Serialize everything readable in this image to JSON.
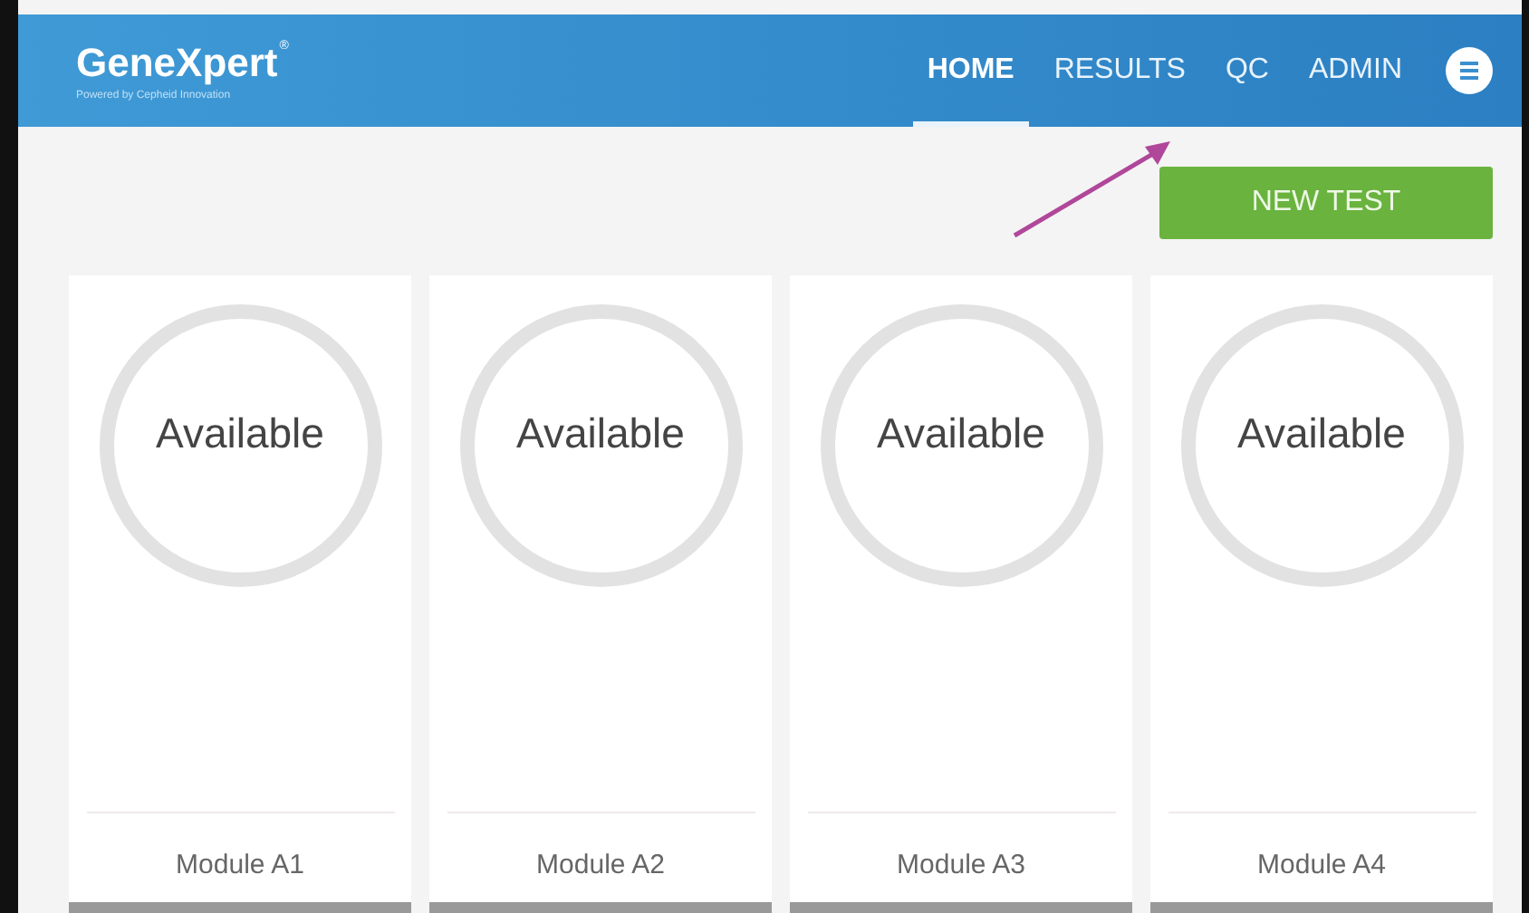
{
  "header": {
    "logo": "GeneXpert",
    "logo_mark": "®",
    "tagline": "Powered by Cepheid Innovation"
  },
  "nav": [
    {
      "label": "HOME",
      "selected": true
    },
    {
      "label": "RESULTS",
      "selected": false
    },
    {
      "label": "QC",
      "selected": false
    },
    {
      "label": "ADMIN",
      "selected": false
    }
  ],
  "new_test_button": "NEW TEST",
  "modules": [
    {
      "status": "Available",
      "name": "Module A1"
    },
    {
      "status": "Available",
      "name": "Module A2"
    },
    {
      "status": "Available",
      "name": "Module A3"
    },
    {
      "status": "Available",
      "name": "Module A4"
    }
  ]
}
